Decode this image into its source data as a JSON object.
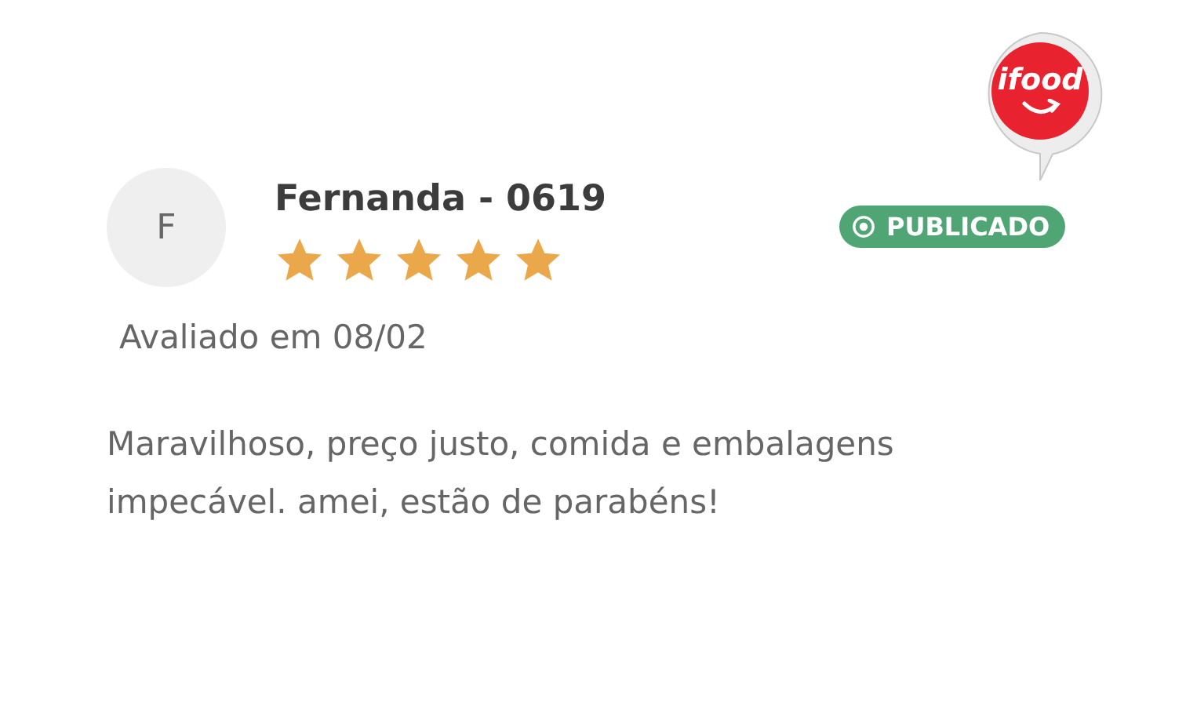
{
  "logo": {
    "text": "ifood"
  },
  "review": {
    "avatar_initial": "F",
    "name": "Fernanda - 0619",
    "stars": 5,
    "status": {
      "label": "PUBLICADO",
      "kind": "published"
    },
    "date": "Avaliado em 08/02",
    "comment": "Maravilhoso, preço justo, comida e embalagens impecável. amei, estão de parabéns!"
  }
}
